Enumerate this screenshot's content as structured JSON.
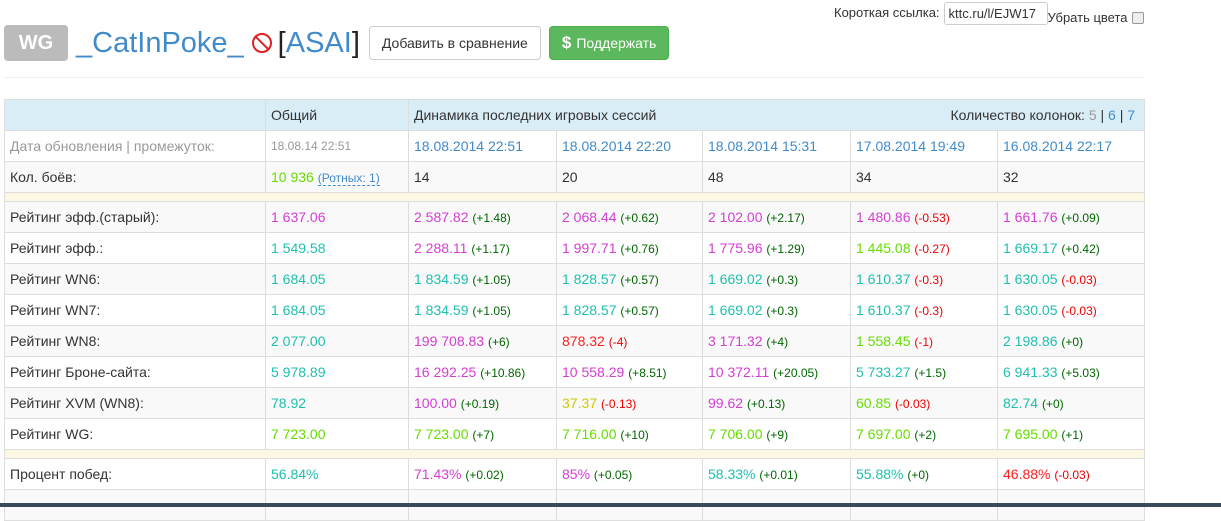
{
  "top": {
    "short_link_label": "Короткая ссылка:",
    "short_link_value": "kttc.ru/l/EJW17",
    "remove_colors_label": "Убрать цвета"
  },
  "header": {
    "badge": "WG",
    "nickname": "_CatInPoke_",
    "clan_open": "[",
    "clan": "ASAI",
    "clan_close": "]",
    "compare_button": "Добавить в сравнение",
    "support_icon": "$",
    "support_button": "Поддержать"
  },
  "table": {
    "col_general": "Общий",
    "col_dynamics": "Динамика последних игровых сессий",
    "columns_label": "Количество колонок:",
    "columns_options": [
      "5",
      "6",
      "7"
    ],
    "sep": "|",
    "date_label": "Дата обновления | промежуток:",
    "date_general": "18.08.14 22:51",
    "dates": [
      "18.08.2014 22:51",
      "18.08.2014 22:20",
      "18.08.2014 15:31",
      "17.08.2014 19:49",
      "16.08.2014 22:17"
    ],
    "battles_label": "Кол. боёв:",
    "battles_general": "10 936",
    "battles_company": "(Ротных: 1)",
    "battles": [
      "14",
      "20",
      "48",
      "34",
      "32"
    ],
    "colors": {
      "purple": "#d43ed4",
      "teal": "#1fbfb0",
      "green": "#66dd00",
      "yellow": "#cccc00",
      "red": "#ff2020"
    },
    "ratings": [
      {
        "label": "Рейтинг эфф.(старый):",
        "general": {
          "v": "1 637.06",
          "c": "purple"
        },
        "cells": [
          {
            "v": "2 587.82",
            "d": "(+1.48)",
            "c": "purple"
          },
          {
            "v": "2 068.44",
            "d": "(+0.62)",
            "c": "purple"
          },
          {
            "v": "2 102.00",
            "d": "(+2.17)",
            "c": "purple"
          },
          {
            "v": "1 480.86",
            "d": "(-0.53)",
            "c": "purple"
          },
          {
            "v": "1 661.76",
            "d": "(+0.09)",
            "c": "purple"
          }
        ]
      },
      {
        "label": "Рейтинг эфф.:",
        "general": {
          "v": "1 549.58",
          "c": "teal"
        },
        "cells": [
          {
            "v": "2 288.11",
            "d": "(+1.17)",
            "c": "purple"
          },
          {
            "v": "1 997.71",
            "d": "(+0.76)",
            "c": "purple"
          },
          {
            "v": "1 775.96",
            "d": "(+1.29)",
            "c": "purple"
          },
          {
            "v": "1 445.08",
            "d": "(-0.27)",
            "c": "green"
          },
          {
            "v": "1 669.17",
            "d": "(+0.42)",
            "c": "teal"
          }
        ]
      },
      {
        "label": "Рейтинг WN6:",
        "general": {
          "v": "1 684.05",
          "c": "teal"
        },
        "cells": [
          {
            "v": "1 834.59",
            "d": "(+1.05)",
            "c": "teal"
          },
          {
            "v": "1 828.57",
            "d": "(+0.57)",
            "c": "teal"
          },
          {
            "v": "1 669.02",
            "d": "(+0.3)",
            "c": "teal"
          },
          {
            "v": "1 610.37",
            "d": "(-0.3)",
            "c": "teal"
          },
          {
            "v": "1 630.05",
            "d": "(-0.03)",
            "c": "teal"
          }
        ]
      },
      {
        "label": "Рейтинг WN7:",
        "general": {
          "v": "1 684.05",
          "c": "teal"
        },
        "cells": [
          {
            "v": "1 834.59",
            "d": "(+1.05)",
            "c": "teal"
          },
          {
            "v": "1 828.57",
            "d": "(+0.57)",
            "c": "teal"
          },
          {
            "v": "1 669.02",
            "d": "(+0.3)",
            "c": "teal"
          },
          {
            "v": "1 610.37",
            "d": "(-0.3)",
            "c": "teal"
          },
          {
            "v": "1 630.05",
            "d": "(-0.03)",
            "c": "teal"
          }
        ]
      },
      {
        "label": "Рейтинг WN8:",
        "general": {
          "v": "2 077.00",
          "c": "teal"
        },
        "cells": [
          {
            "v": "199 708.83",
            "d": "(+6)",
            "c": "purple"
          },
          {
            "v": "878.32",
            "d": "(-4)",
            "c": "red"
          },
          {
            "v": "3 171.32",
            "d": "(+4)",
            "c": "purple"
          },
          {
            "v": "1 558.45",
            "d": "(-1)",
            "c": "green"
          },
          {
            "v": "2 198.86",
            "d": "(+0)",
            "c": "teal"
          }
        ]
      },
      {
        "label": "Рейтинг Броне-сайта:",
        "general": {
          "v": "5 978.89",
          "c": "teal"
        },
        "cells": [
          {
            "v": "16 292.25",
            "d": "(+10.86)",
            "c": "purple"
          },
          {
            "v": "10 558.29",
            "d": "(+8.51)",
            "c": "purple"
          },
          {
            "v": "10 372.11",
            "d": "(+20.05)",
            "c": "purple"
          },
          {
            "v": "5 733.27",
            "d": "(+1.5)",
            "c": "teal"
          },
          {
            "v": "6 941.33",
            "d": "(+5.03)",
            "c": "teal"
          }
        ]
      },
      {
        "label": "Рейтинг XVM (WN8):",
        "general": {
          "v": "78.92",
          "c": "teal"
        },
        "cells": [
          {
            "v": "100.00",
            "d": "(+0.19)",
            "c": "purple"
          },
          {
            "v": "37.37",
            "d": "(-0.13)",
            "c": "yellow"
          },
          {
            "v": "99.62",
            "d": "(+0.13)",
            "c": "purple"
          },
          {
            "v": "60.85",
            "d": "(-0.03)",
            "c": "green"
          },
          {
            "v": "82.74",
            "d": "(+0)",
            "c": "teal"
          }
        ]
      },
      {
        "label": "Рейтинг WG:",
        "general": {
          "v": "7 723.00",
          "c": "green"
        },
        "cells": [
          {
            "v": "7 723.00",
            "d": "(+7)",
            "c": "green"
          },
          {
            "v": "7 716.00",
            "d": "(+10)",
            "c": "green"
          },
          {
            "v": "7 706.00",
            "d": "(+9)",
            "c": "green"
          },
          {
            "v": "7 697.00",
            "d": "(+2)",
            "c": "green"
          },
          {
            "v": "7 695.00",
            "d": "(+1)",
            "c": "green"
          }
        ]
      }
    ],
    "winrate": {
      "label": "Процент побед:",
      "general": {
        "v": "56.84%",
        "c": "teal"
      },
      "cells": [
        {
          "v": "71.43%",
          "d": "(+0.02)",
          "c": "purple"
        },
        {
          "v": "85%",
          "d": "(+0.05)",
          "c": "purple"
        },
        {
          "v": "58.33%",
          "d": "(+0.01)",
          "c": "teal"
        },
        {
          "v": "55.88%",
          "d": "(+0)",
          "c": "teal"
        },
        {
          "v": "46.88%",
          "d": "(-0.03)",
          "c": "red"
        }
      ]
    }
  }
}
